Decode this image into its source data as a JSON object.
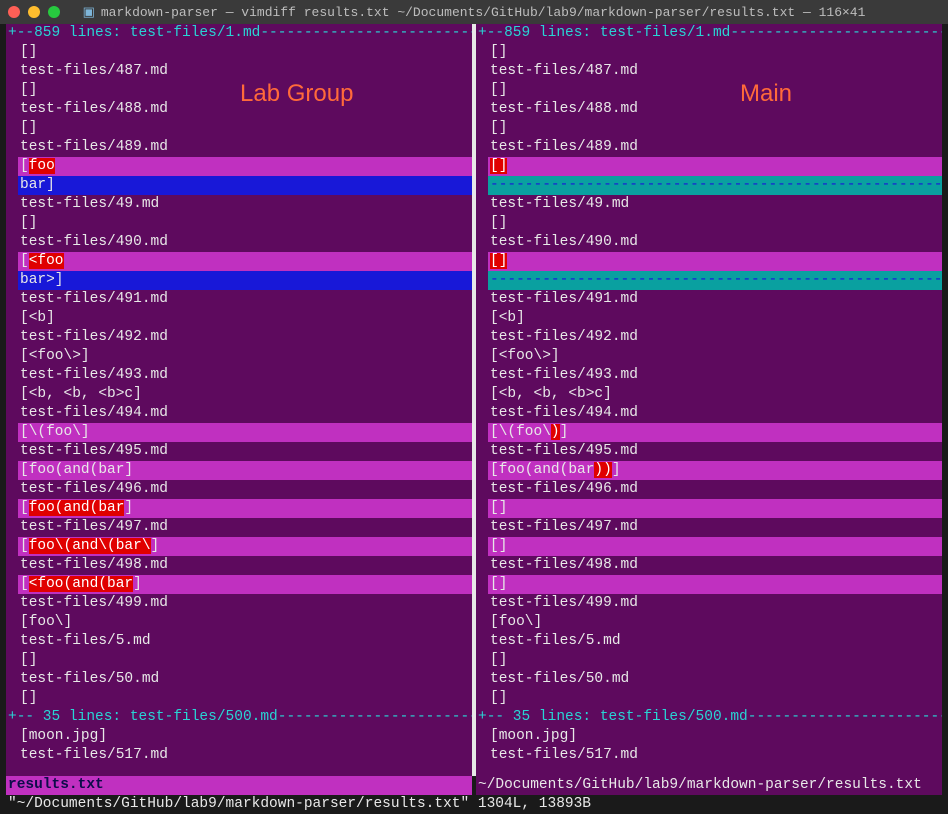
{
  "window": {
    "title": "markdown-parser — vimdiff results.txt ~/Documents/GitHub/lab9/markdown-parser/results.txt — 116×41"
  },
  "annotations": {
    "left": "Lab Group",
    "right": "Main"
  },
  "fold_top": {
    "prefix": "+",
    "text": "--859 lines: test-files/1.md",
    "dashes": "--------------------------------"
  },
  "fold_bottom": {
    "prefix": "+",
    "text": "-- 35 lines: test-files/500.md",
    "dashes": "------------------------------"
  },
  "left_pane": {
    "lines": [
      {
        "t": "[]",
        "cls": ""
      },
      {
        "t": "test-files/487.md",
        "cls": ""
      },
      {
        "t": "[]",
        "cls": ""
      },
      {
        "t": "test-files/488.md",
        "cls": ""
      },
      {
        "t": "[]",
        "cls": ""
      },
      {
        "t": "test-files/489.md",
        "cls": ""
      },
      {
        "seg": [
          {
            "t": "[",
            "cls": "bg-magenta"
          },
          {
            "t": "foo",
            "cls": "hl-red"
          }
        ],
        "row": "bg-magenta"
      },
      {
        "seg": [
          {
            "t": "bar]",
            "cls": ""
          }
        ],
        "row": "bg-blue"
      },
      {
        "t": "test-files/49.md",
        "cls": ""
      },
      {
        "t": "[]",
        "cls": ""
      },
      {
        "t": "test-files/490.md",
        "cls": ""
      },
      {
        "seg": [
          {
            "t": "[",
            "cls": "bg-magenta"
          },
          {
            "t": "<foo",
            "cls": "hl-red"
          }
        ],
        "row": "bg-magenta"
      },
      {
        "seg": [
          {
            "t": "bar>]",
            "cls": ""
          }
        ],
        "row": "bg-blue"
      },
      {
        "t": "test-files/491.md",
        "cls": ""
      },
      {
        "t": "[<b]",
        "cls": ""
      },
      {
        "t": "test-files/492.md",
        "cls": ""
      },
      {
        "t": "[<foo\\>]",
        "cls": ""
      },
      {
        "t": "test-files/493.md",
        "cls": ""
      },
      {
        "t": "[<b, <b, <b>c]",
        "cls": ""
      },
      {
        "t": "test-files/494.md",
        "cls": ""
      },
      {
        "seg": [
          {
            "t": "[\\(foo\\",
            "cls": ""
          },
          {
            "t": "]",
            "cls": ""
          }
        ],
        "row": "bg-magenta"
      },
      {
        "t": "test-files/495.md",
        "cls": ""
      },
      {
        "seg": [
          {
            "t": "[foo(and(bar",
            "cls": ""
          },
          {
            "t": "]",
            "cls": ""
          }
        ],
        "row": "bg-magenta"
      },
      {
        "t": "test-files/496.md",
        "cls": ""
      },
      {
        "seg": [
          {
            "t": "[",
            "cls": ""
          },
          {
            "t": "foo(and(bar",
            "cls": "hl-red"
          },
          {
            "t": "]",
            "cls": ""
          }
        ],
        "row": "bg-magenta"
      },
      {
        "t": "test-files/497.md",
        "cls": ""
      },
      {
        "seg": [
          {
            "t": "[",
            "cls": ""
          },
          {
            "t": "foo\\(and\\(bar\\",
            "cls": "hl-red"
          },
          {
            "t": "]",
            "cls": ""
          }
        ],
        "row": "bg-magenta"
      },
      {
        "t": "test-files/498.md",
        "cls": ""
      },
      {
        "seg": [
          {
            "t": "[",
            "cls": ""
          },
          {
            "t": "<foo(and(bar",
            "cls": "hl-red"
          },
          {
            "t": "]",
            "cls": ""
          }
        ],
        "row": "bg-magenta"
      },
      {
        "t": "test-files/499.md",
        "cls": ""
      },
      {
        "t": "[foo\\]",
        "cls": ""
      },
      {
        "t": "test-files/5.md",
        "cls": ""
      },
      {
        "t": "[]",
        "cls": ""
      },
      {
        "t": "test-files/50.md",
        "cls": ""
      },
      {
        "t": "[]",
        "cls": ""
      }
    ],
    "tail": [
      {
        "t": "[moon.jpg]",
        "cls": ""
      },
      {
        "t": "test-files/517.md",
        "cls": ""
      }
    ],
    "status": "results.txt"
  },
  "right_pane": {
    "lines": [
      {
        "t": "[]",
        "cls": ""
      },
      {
        "t": "test-files/487.md",
        "cls": ""
      },
      {
        "t": "[]",
        "cls": ""
      },
      {
        "t": "test-files/488.md",
        "cls": ""
      },
      {
        "t": "[]",
        "cls": ""
      },
      {
        "t": "test-files/489.md",
        "cls": ""
      },
      {
        "seg": [
          {
            "t": "[]",
            "cls": "hl-red"
          }
        ],
        "row": "bg-magenta"
      },
      {
        "t": "----------------------------------------------------------------",
        "row": "dashfill"
      },
      {
        "t": "test-files/49.md",
        "cls": ""
      },
      {
        "t": "[]",
        "cls": ""
      },
      {
        "t": "test-files/490.md",
        "cls": ""
      },
      {
        "seg": [
          {
            "t": "[]",
            "cls": "hl-red"
          }
        ],
        "row": "bg-magenta"
      },
      {
        "t": "----------------------------------------------------------------",
        "row": "dashfill"
      },
      {
        "t": "test-files/491.md",
        "cls": ""
      },
      {
        "t": "[<b]",
        "cls": ""
      },
      {
        "t": "test-files/492.md",
        "cls": ""
      },
      {
        "t": "[<foo\\>]",
        "cls": ""
      },
      {
        "t": "test-files/493.md",
        "cls": ""
      },
      {
        "t": "[<b, <b, <b>c]",
        "cls": ""
      },
      {
        "t": "test-files/494.md",
        "cls": ""
      },
      {
        "seg": [
          {
            "t": "[\\(foo\\",
            "cls": ""
          },
          {
            "t": ")",
            "cls": "hl-red"
          },
          {
            "t": "]",
            "cls": ""
          }
        ],
        "row": "bg-magenta"
      },
      {
        "t": "test-files/495.md",
        "cls": ""
      },
      {
        "seg": [
          {
            "t": "[foo(and(bar",
            "cls": ""
          },
          {
            "t": "))",
            "cls": "hl-red"
          },
          {
            "t": "]",
            "cls": ""
          }
        ],
        "row": "bg-magenta"
      },
      {
        "t": "test-files/496.md",
        "cls": ""
      },
      {
        "seg": [
          {
            "t": "[]",
            "cls": ""
          }
        ],
        "row": "bg-magenta"
      },
      {
        "t": "test-files/497.md",
        "cls": ""
      },
      {
        "seg": [
          {
            "t": "[]",
            "cls": ""
          }
        ],
        "row": "bg-magenta"
      },
      {
        "t": "test-files/498.md",
        "cls": ""
      },
      {
        "seg": [
          {
            "t": "[]",
            "cls": ""
          }
        ],
        "row": "bg-magenta"
      },
      {
        "t": "test-files/499.md",
        "cls": ""
      },
      {
        "t": "[foo\\]",
        "cls": ""
      },
      {
        "t": "test-files/5.md",
        "cls": ""
      },
      {
        "t": "[]",
        "cls": ""
      },
      {
        "t": "test-files/50.md",
        "cls": ""
      },
      {
        "t": "[]",
        "cls": ""
      }
    ],
    "tail": [
      {
        "t": "[moon.jpg]",
        "cls": ""
      },
      {
        "t": "test-files/517.md",
        "cls": ""
      }
    ],
    "status": "~/Documents/GitHub/lab9/markdown-parser/results.txt"
  },
  "command_line": "\"~/Documents/GitHub/lab9/markdown-parser/results.txt\" 1304L, 13893B"
}
